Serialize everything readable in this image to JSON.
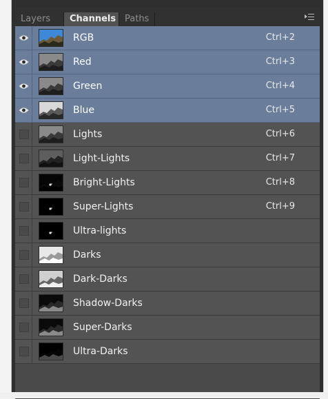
{
  "tabs": [
    {
      "label": "Layers",
      "active": false
    },
    {
      "label": "Channels",
      "active": true
    },
    {
      "label": "Paths",
      "active": false
    }
  ],
  "panel_menu_icon": "panel-menu-icon",
  "channels": [
    {
      "name": "RGB",
      "shortcut": "Ctrl+2",
      "visible": true,
      "selected": true,
      "thumb": "rgb"
    },
    {
      "name": "Red",
      "shortcut": "Ctrl+3",
      "visible": true,
      "selected": true,
      "thumb": "gray"
    },
    {
      "name": "Green",
      "shortcut": "Ctrl+4",
      "visible": true,
      "selected": true,
      "thumb": "gray"
    },
    {
      "name": "Blue",
      "shortcut": "Ctrl+5",
      "visible": true,
      "selected": true,
      "thumb": "light"
    },
    {
      "name": "Lights",
      "shortcut": "Ctrl+6",
      "visible": false,
      "selected": false,
      "thumb": "gray"
    },
    {
      "name": "Light-Lights",
      "shortcut": "Ctrl+7",
      "visible": false,
      "selected": false,
      "thumb": "darkgray"
    },
    {
      "name": "Bright-Lights",
      "shortcut": "Ctrl+8",
      "visible": false,
      "selected": false,
      "thumb": "black-spot"
    },
    {
      "name": "Super-Lights",
      "shortcut": "Ctrl+9",
      "visible": false,
      "selected": false,
      "thumb": "black-dot"
    },
    {
      "name": "Ultra-lights",
      "shortcut": "",
      "visible": false,
      "selected": false,
      "thumb": "black-dot"
    },
    {
      "name": "Darks",
      "shortcut": "",
      "visible": false,
      "selected": false,
      "thumb": "white"
    },
    {
      "name": "Dark-Darks",
      "shortcut": "",
      "visible": false,
      "selected": false,
      "thumb": "whitegray"
    },
    {
      "name": "Shadow-Darks",
      "shortcut": "",
      "visible": false,
      "selected": false,
      "thumb": "blacktex"
    },
    {
      "name": "Super-Darks",
      "shortcut": "",
      "visible": false,
      "selected": false,
      "thumb": "blacktex"
    },
    {
      "name": "Ultra-Darks",
      "shortcut": "",
      "visible": false,
      "selected": false,
      "thumb": "black"
    }
  ],
  "colors": {
    "selected_row": "#6a7e9b",
    "row": "#535353",
    "panel": "#4a4a4a"
  }
}
